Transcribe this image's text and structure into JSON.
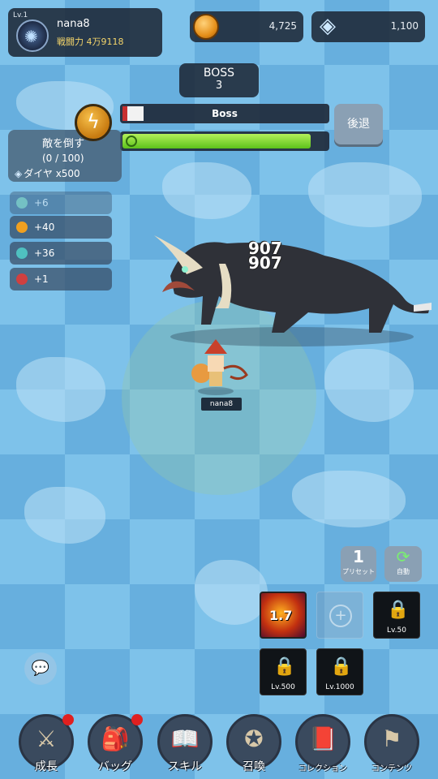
{
  "profile": {
    "level": "Lv.1",
    "name": "nana8",
    "power": "戦闘力 4万9118"
  },
  "currency": {
    "gold": "4,725",
    "diamond": "1,100"
  },
  "boss": {
    "label": "BOSS",
    "stage": "3",
    "name": "Boss",
    "hp_fraction": 0.1,
    "timer_fraction": 0.92
  },
  "retreat_label": "後退",
  "quest": {
    "title": "敵を倒す",
    "progress": "(0 / 100)",
    "reward": "ダイヤ x500"
  },
  "gains": [
    "+6",
    "+40",
    "+36",
    "+1"
  ],
  "damage": [
    "907",
    "907"
  ],
  "player_tag": "nana8",
  "preset": {
    "number": "1",
    "label": "プリセット"
  },
  "auto_label": "自動",
  "skill": {
    "cooldown": "1.7"
  },
  "locks": [
    "Lv.50",
    "Lv.500",
    "Lv.1000"
  ],
  "nav": [
    {
      "label": "成長",
      "icon": "growth-icon"
    },
    {
      "label": "バッグ",
      "icon": "bag-icon"
    },
    {
      "label": "スキル",
      "icon": "skill-icon"
    },
    {
      "label": "召喚",
      "icon": "summon-icon"
    },
    {
      "label": "コレクション",
      "icon": "collection-icon"
    },
    {
      "label": "コンテンツ",
      "icon": "content-icon"
    }
  ]
}
